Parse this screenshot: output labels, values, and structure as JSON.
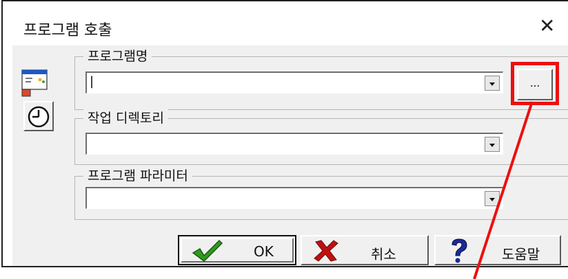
{
  "dialog": {
    "title": "프로그램 호출",
    "close_symbol": "✕"
  },
  "program_name": {
    "label": "프로그램명",
    "value": "|"
  },
  "working_dir": {
    "label": "작업 디렉토리",
    "value": ""
  },
  "program_params": {
    "label": "프로그램 파라미터",
    "value": ""
  },
  "browse_button": {
    "label": "..."
  },
  "buttons": {
    "ok": "OK",
    "cancel": "취소",
    "help": "도움말"
  },
  "colors": {
    "highlight": "#ec1010",
    "ok_check": "#2e9a1e",
    "cancel_x": "#c01010",
    "help_q": "#1a2a9a"
  }
}
